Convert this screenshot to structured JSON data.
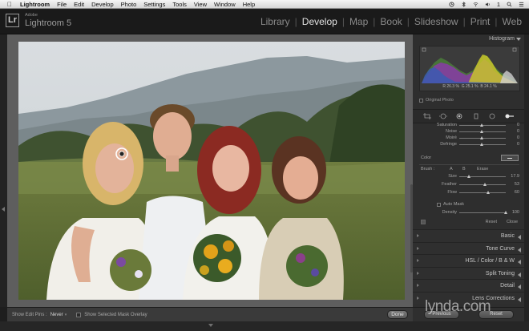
{
  "menubar": {
    "apple": "",
    "items": [
      "Lightroom",
      "File",
      "Edit",
      "Develop",
      "Photo",
      "Settings",
      "Tools",
      "View",
      "Window",
      "Help"
    ],
    "right_number": "1"
  },
  "identity": {
    "logo": "Lr",
    "adobe": "Adobe",
    "name": "Lightroom 5"
  },
  "modules": {
    "items": [
      "Library",
      "Develop",
      "Map",
      "Book",
      "Slideshow",
      "Print",
      "Web"
    ],
    "active": "Develop"
  },
  "histogram": {
    "title": "Histogram",
    "readout": {
      "r_label": "R",
      "r_value": "26.3",
      "g_label": "G",
      "g_value": "25.1",
      "b_label": "B",
      "b_value": "24.1",
      "unit": "%"
    },
    "original_photo_label": "Original Photo"
  },
  "brush_panel": {
    "sliders": [
      {
        "label": "Saturation",
        "value": "0"
      },
      {
        "label": "Noise",
        "value": "0"
      },
      {
        "label": "Moiré",
        "value": "0"
      },
      {
        "label": "Defringe",
        "value": "0"
      }
    ],
    "color_label": "Color",
    "brush": {
      "label": "Brush :",
      "a": "A",
      "b": "B",
      "erase": "Erase"
    },
    "brush_sliders": [
      {
        "label": "Size",
        "value": "17.9"
      },
      {
        "label": "Feather",
        "value": "53"
      },
      {
        "label": "Flow",
        "value": "60"
      }
    ],
    "auto_mask_label": "Auto Mask",
    "density": {
      "label": "Density",
      "value": "100"
    },
    "reset_label": "Reset",
    "close_label": "Close"
  },
  "sections": [
    {
      "label": "Basic"
    },
    {
      "label": "Tone Curve"
    },
    {
      "label": "HSL  /  Color  /  B & W"
    },
    {
      "label": "Split Toning"
    },
    {
      "label": "Detail"
    },
    {
      "label": "Lens Corrections"
    }
  ],
  "toolbar": {
    "show_edit_pins_label": "Show Edit Pins :",
    "show_edit_pins_value": "Never",
    "show_mask_overlay_label": "Show Selected Mask Overlay",
    "done_label": "Done"
  },
  "right_footer": {
    "previous_label": "Previous",
    "reset_label": "Reset"
  },
  "watermark": "lynda.com",
  "colors": {
    "background": "#1e1e1e",
    "panel": "#2e2e2e",
    "canvas_gray": "#5e5e5e",
    "active_module": "#e2e2e2",
    "inactive_module": "#8b8b8b"
  }
}
